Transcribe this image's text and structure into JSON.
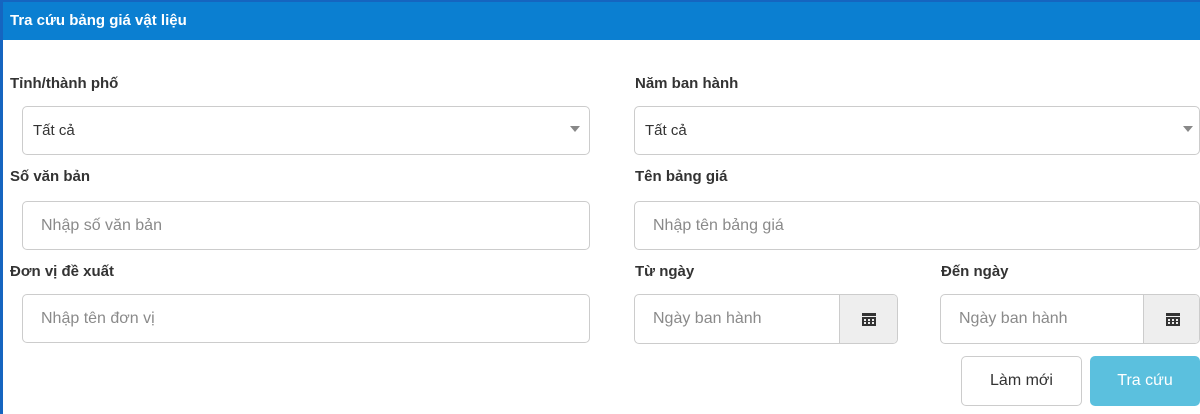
{
  "panel": {
    "title": "Tra cứu bảng giá vật liệu"
  },
  "fields": {
    "province": {
      "label": "Tỉnh/thành phố",
      "value": "Tất cả"
    },
    "year": {
      "label": "Năm ban hành",
      "value": "Tất cả"
    },
    "doc_number": {
      "label": "Số văn bản",
      "placeholder": "Nhập số văn bản",
      "value": ""
    },
    "price_table_name": {
      "label": "Tên bảng giá",
      "placeholder": "Nhập tên bảng giá",
      "value": ""
    },
    "proposing_unit": {
      "label": "Đơn vị đề xuất",
      "placeholder": "Nhập tên đơn vị",
      "value": ""
    },
    "from_date": {
      "label": "Từ ngày",
      "placeholder": "Ngày ban hành",
      "value": ""
    },
    "to_date": {
      "label": "Đến ngày",
      "placeholder": "Ngày ban hành",
      "value": ""
    }
  },
  "buttons": {
    "reset_label": "Làm mới",
    "search_label": "Tra cứu"
  },
  "colors": {
    "header_bg": "#0b7fd1",
    "search_button": "#5bc0de"
  },
  "icons": {
    "calendar": "calendar-icon",
    "caret": "caret-down-icon"
  }
}
